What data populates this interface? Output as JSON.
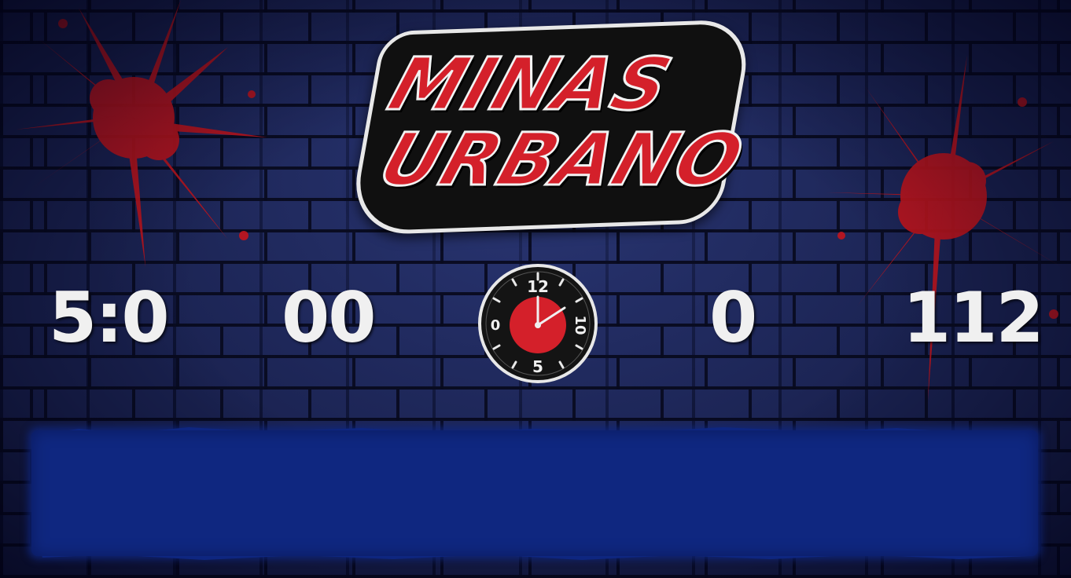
{
  "logo": {
    "line1": "MINAS",
    "line2": "URBANO"
  },
  "scoreboard": {
    "left_time": "5:0",
    "left_score": "00",
    "right_score": "0",
    "right_value": "112"
  },
  "clock": {
    "top_label": "12",
    "right_label": "10",
    "bottom_label": "5",
    "left_label": "0"
  },
  "colors": {
    "wall": "#1a2250",
    "paint_red": "#d4202a",
    "banner_blue": "#0f2780",
    "text_white": "#f0f0f0"
  },
  "banner": {
    "text": ""
  }
}
